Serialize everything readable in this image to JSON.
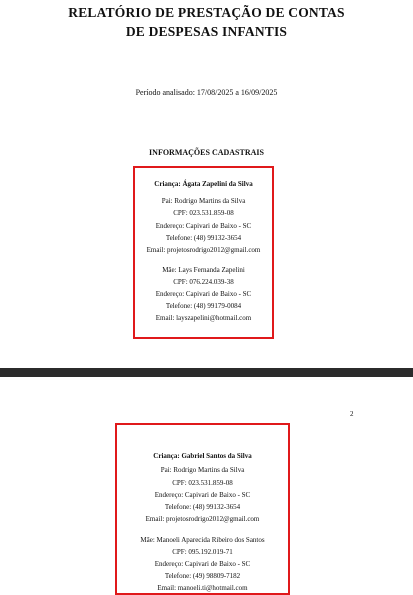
{
  "document": {
    "title_line1": "RELATÓRIO DE PRESTAÇÃO DE CONTAS",
    "title_line2": "DE DESPESAS INFANTIS",
    "period": "Período analisado: 17/08/2025 a 16/09/2025",
    "section_title": "INFORMAÇÕES CADASTRAIS",
    "page_number": "2"
  },
  "child1": {
    "child": "Criança: Ágata  Zapelini da Silva",
    "father": "Pai: Rodrigo Martins da Silva",
    "father_cpf": "CPF: 023.531.859-08",
    "father_address": "Endereço: Capivari de Baixo - SC",
    "father_phone": "Telefone: (48) 99132-3654",
    "father_email": "Email: projetosrodrigo2012@gmail.com",
    "mother": "Mãe: Lays Fernanda Zapelini",
    "mother_cpf": "CPF: 076.224.039-38",
    "mother_address": "Endereço: Capivari de Baixo - SC",
    "mother_phone": "Telefone: (48) 99179-0084",
    "mother_email": "Email: layszapelini@hotmail.com"
  },
  "child2": {
    "child": "Criança: Gabriel Santos da Silva",
    "father": "Pai: Rodrigo Martins da Silva",
    "father_cpf": "CPF: 023.531.859-08",
    "father_address": "Endereço: Capivari de Baixo - SC",
    "father_phone": "Telefone: (48) 99132-3654",
    "father_email": "Email: projetosrodrigo2012@gmail.com",
    "mother": "Mãe: Manoeli Aparecida Ribeiro dos Santos",
    "mother_cpf": "CPF: 095.192.019-71",
    "mother_address": "Endereço: Capivari de Baixo - SC",
    "mother_phone": "Telefone: (49) 98809-7182",
    "mother_email": "Email: manoeli.ti@hotmail.com"
  },
  "colors": {
    "highlight_border": "#e0191b",
    "page_separator": "#2b2b2b"
  }
}
